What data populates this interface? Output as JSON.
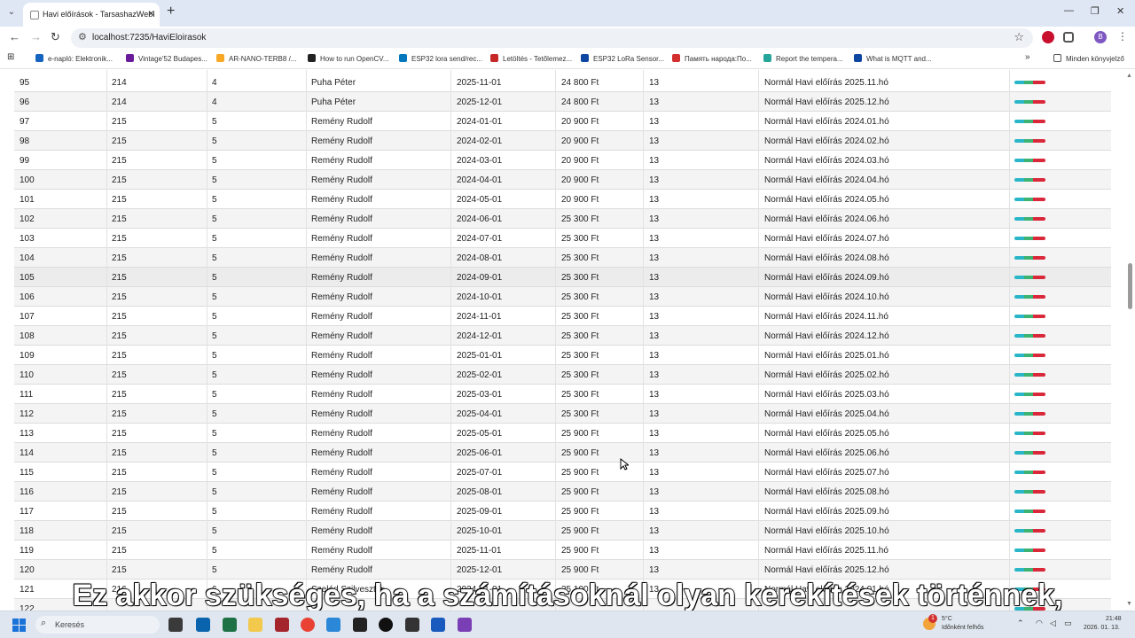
{
  "browser": {
    "tab_title": "Havi előírások - TarsashazWebI",
    "url": "localhost:7235/HaviEloirasok",
    "bookmarks": [
      "e-napló: Elektronik...",
      "Vintage'52 Budapes...",
      "AR-NANO-TERB8 /...",
      "How to run OpenCV...",
      "ESP32 lora send/rec...",
      "Letöltés - Tetőlemez...",
      "ESP32 LoRa Sensor...",
      "Память народа:По...",
      "Report the tempera...",
      "What is MQTT and..."
    ],
    "all_bookmarks": "Minden könyvjelző",
    "profile_initial": "B"
  },
  "table": {
    "rows": [
      {
        "id": "95",
        "lakas": "214",
        "emelet": "4",
        "nev": "Puha Péter",
        "datum": "2025-11-01",
        "osszeg": "24 800 Ft",
        "kod": "13",
        "leiras": "Normál Havi előírás 2025.11.hó"
      },
      {
        "id": "96",
        "lakas": "214",
        "emelet": "4",
        "nev": "Puha Péter",
        "datum": "2025-12-01",
        "osszeg": "24 800 Ft",
        "kod": "13",
        "leiras": "Normál Havi előírás 2025.12.hó"
      },
      {
        "id": "97",
        "lakas": "215",
        "emelet": "5",
        "nev": "Remény Rudolf",
        "datum": "2024-01-01",
        "osszeg": "20 900 Ft",
        "kod": "13",
        "leiras": "Normál Havi előírás 2024.01.hó"
      },
      {
        "id": "98",
        "lakas": "215",
        "emelet": "5",
        "nev": "Remény Rudolf",
        "datum": "2024-02-01",
        "osszeg": "20 900 Ft",
        "kod": "13",
        "leiras": "Normál Havi előírás 2024.02.hó"
      },
      {
        "id": "99",
        "lakas": "215",
        "emelet": "5",
        "nev": "Remény Rudolf",
        "datum": "2024-03-01",
        "osszeg": "20 900 Ft",
        "kod": "13",
        "leiras": "Normál Havi előírás 2024.03.hó"
      },
      {
        "id": "100",
        "lakas": "215",
        "emelet": "5",
        "nev": "Remény Rudolf",
        "datum": "2024-04-01",
        "osszeg": "20 900 Ft",
        "kod": "13",
        "leiras": "Normál Havi előírás 2024.04.hó"
      },
      {
        "id": "101",
        "lakas": "215",
        "emelet": "5",
        "nev": "Remény Rudolf",
        "datum": "2024-05-01",
        "osszeg": "20 900 Ft",
        "kod": "13",
        "leiras": "Normál Havi előírás 2024.05.hó"
      },
      {
        "id": "102",
        "lakas": "215",
        "emelet": "5",
        "nev": "Remény Rudolf",
        "datum": "2024-06-01",
        "osszeg": "25 300 Ft",
        "kod": "13",
        "leiras": "Normál Havi előírás 2024.06.hó"
      },
      {
        "id": "103",
        "lakas": "215",
        "emelet": "5",
        "nev": "Remény Rudolf",
        "datum": "2024-07-01",
        "osszeg": "25 300 Ft",
        "kod": "13",
        "leiras": "Normál Havi előírás 2024.07.hó"
      },
      {
        "id": "104",
        "lakas": "215",
        "emelet": "5",
        "nev": "Remény Rudolf",
        "datum": "2024-08-01",
        "osszeg": "25 300 Ft",
        "kod": "13",
        "leiras": "Normál Havi előírás 2024.08.hó"
      },
      {
        "id": "105",
        "lakas": "215",
        "emelet": "5",
        "nev": "Remény Rudolf",
        "datum": "2024-09-01",
        "osszeg": "25 300 Ft",
        "kod": "13",
        "leiras": "Normál Havi előírás 2024.09.hó"
      },
      {
        "id": "106",
        "lakas": "215",
        "emelet": "5",
        "nev": "Remény Rudolf",
        "datum": "2024-10-01",
        "osszeg": "25 300 Ft",
        "kod": "13",
        "leiras": "Normál Havi előírás 2024.10.hó"
      },
      {
        "id": "107",
        "lakas": "215",
        "emelet": "5",
        "nev": "Remény Rudolf",
        "datum": "2024-11-01",
        "osszeg": "25 300 Ft",
        "kod": "13",
        "leiras": "Normál Havi előírás 2024.11.hó"
      },
      {
        "id": "108",
        "lakas": "215",
        "emelet": "5",
        "nev": "Remény Rudolf",
        "datum": "2024-12-01",
        "osszeg": "25 300 Ft",
        "kod": "13",
        "leiras": "Normál Havi előírás 2024.12.hó"
      },
      {
        "id": "109",
        "lakas": "215",
        "emelet": "5",
        "nev": "Remény Rudolf",
        "datum": "2025-01-01",
        "osszeg": "25 300 Ft",
        "kod": "13",
        "leiras": "Normál Havi előírás 2025.01.hó"
      },
      {
        "id": "110",
        "lakas": "215",
        "emelet": "5",
        "nev": "Remény Rudolf",
        "datum": "2025-02-01",
        "osszeg": "25 300 Ft",
        "kod": "13",
        "leiras": "Normál Havi előírás 2025.02.hó"
      },
      {
        "id": "111",
        "lakas": "215",
        "emelet": "5",
        "nev": "Remény Rudolf",
        "datum": "2025-03-01",
        "osszeg": "25 300 Ft",
        "kod": "13",
        "leiras": "Normál Havi előírás 2025.03.hó"
      },
      {
        "id": "112",
        "lakas": "215",
        "emelet": "5",
        "nev": "Remény Rudolf",
        "datum": "2025-04-01",
        "osszeg": "25 300 Ft",
        "kod": "13",
        "leiras": "Normál Havi előírás 2025.04.hó"
      },
      {
        "id": "113",
        "lakas": "215",
        "emelet": "5",
        "nev": "Remény Rudolf",
        "datum": "2025-05-01",
        "osszeg": "25 900 Ft",
        "kod": "13",
        "leiras": "Normál Havi előírás 2025.05.hó"
      },
      {
        "id": "114",
        "lakas": "215",
        "emelet": "5",
        "nev": "Remény Rudolf",
        "datum": "2025-06-01",
        "osszeg": "25 900 Ft",
        "kod": "13",
        "leiras": "Normál Havi előírás 2025.06.hó"
      },
      {
        "id": "115",
        "lakas": "215",
        "emelet": "5",
        "nev": "Remény Rudolf",
        "datum": "2025-07-01",
        "osszeg": "25 900 Ft",
        "kod": "13",
        "leiras": "Normál Havi előírás 2025.07.hó"
      },
      {
        "id": "116",
        "lakas": "215",
        "emelet": "5",
        "nev": "Remény Rudolf",
        "datum": "2025-08-01",
        "osszeg": "25 900 Ft",
        "kod": "13",
        "leiras": "Normál Havi előírás 2025.08.hó"
      },
      {
        "id": "117",
        "lakas": "215",
        "emelet": "5",
        "nev": "Remény Rudolf",
        "datum": "2025-09-01",
        "osszeg": "25 900 Ft",
        "kod": "13",
        "leiras": "Normál Havi előírás 2025.09.hó"
      },
      {
        "id": "118",
        "lakas": "215",
        "emelet": "5",
        "nev": "Remény Rudolf",
        "datum": "2025-10-01",
        "osszeg": "25 900 Ft",
        "kod": "13",
        "leiras": "Normál Havi előírás 2025.10.hó"
      },
      {
        "id": "119",
        "lakas": "215",
        "emelet": "5",
        "nev": "Remény Rudolf",
        "datum": "2025-11-01",
        "osszeg": "25 900 Ft",
        "kod": "13",
        "leiras": "Normál Havi előírás 2025.11.hó"
      },
      {
        "id": "120",
        "lakas": "215",
        "emelet": "5",
        "nev": "Remény Rudolf",
        "datum": "2025-12-01",
        "osszeg": "25 900 Ft",
        "kod": "13",
        "leiras": "Normál Havi előírás 2025.12.hó"
      },
      {
        "id": "121",
        "lakas": "216",
        "emelet": "6",
        "nev": "Szeléd Szilveszter",
        "datum": "2024-01-01",
        "osszeg": "25 100 Ft",
        "kod": "13",
        "leiras": "Normál Havi előírás 2024.01.hó"
      },
      {
        "id": "122",
        "lakas": "",
        "emelet": "",
        "nev": "",
        "datum": "",
        "osszeg": "",
        "kod": "",
        "leiras": ""
      }
    ],
    "action_colors": [
      "#29b6c8",
      "#3cb371",
      "#d9283a"
    ]
  },
  "subtitle": "Ez akkor szükséges, ha a számításoknál olyan kerekítések történnek,",
  "taskbar": {
    "search_placeholder": "Keresés",
    "weather_temp": "5°C",
    "weather_desc": "Időnként felhős",
    "time": "21:48",
    "date": "2026. 01. 13.",
    "notification_count": "1"
  }
}
